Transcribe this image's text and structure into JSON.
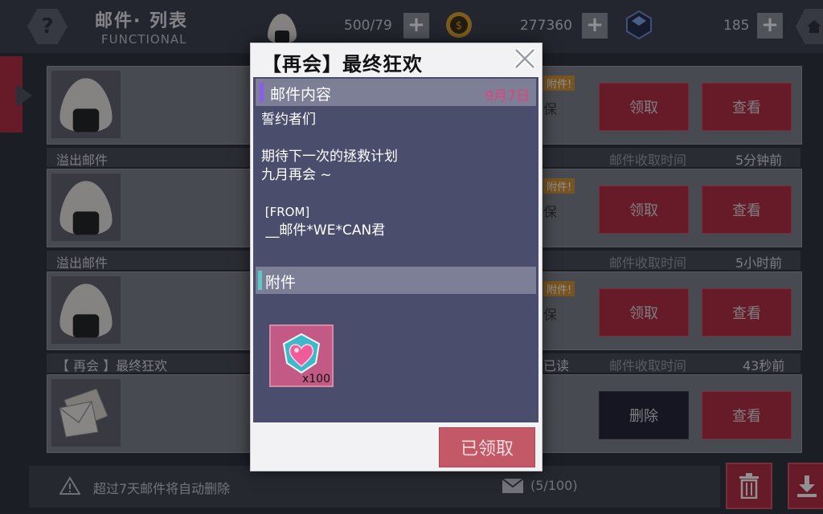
{
  "header": {
    "title_cn": "邮件· 列表",
    "title_en": "FUNCTIONAL",
    "help_label": "?",
    "resources": [
      {
        "value": "500/79",
        "icon": "onigiri-icon"
      },
      {
        "value": "277360",
        "icon": "coin-icon"
      },
      {
        "value": "185",
        "icon": "crystal-icon"
      }
    ]
  },
  "list": {
    "rows": [
      {
        "title": "",
        "time_label": "",
        "time_value": "",
        "tag": "附件!",
        "extra": "保",
        "btn1": "领取",
        "btn2": "查看"
      },
      {
        "title": "溢出邮件",
        "time_label": "邮件收取时间",
        "time_value": "5分钟前",
        "tag": "附件!",
        "extra": "保",
        "btn1": "领取",
        "btn2": "查看"
      },
      {
        "title": "溢出邮件",
        "time_label": "邮件收取时间",
        "time_value": "5小时前",
        "tag": "附件!",
        "extra": "保",
        "btn1": "领取",
        "btn2": "查看"
      },
      {
        "title": "【 再会 】最终狂欢",
        "time_label": "邮件收取时间",
        "time_value": "43秒前",
        "tag": "已读",
        "extra": "",
        "btn1": "删除",
        "btn2": "查看"
      }
    ]
  },
  "footer": {
    "notice": "超过7天邮件将自动删除",
    "mail_count": "(5/100)"
  },
  "modal": {
    "title": "【再会】最终狂欢",
    "content_header": "邮件内容",
    "date": "9月7日",
    "message_lines": [
      "誓约者们",
      "",
      "期待下一次的拯救计划",
      "九月再会 ~",
      "",
      " [FROM]",
      " __邮件*WE*CAN君"
    ],
    "attachment_header": "附件",
    "item_count": "x100",
    "claimed_label": "已领取"
  },
  "colors": {
    "accent_red": "#b3283d",
    "date_pink": "#ea3d7d",
    "content_bar": "#8a5cf0",
    "attach_bar": "#5ec7c9"
  }
}
